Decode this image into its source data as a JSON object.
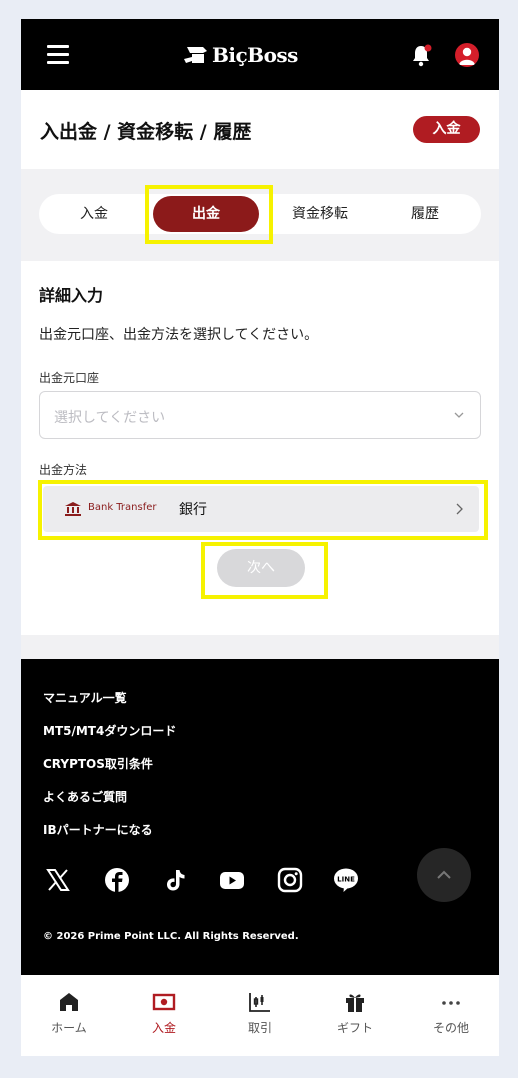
{
  "header": {
    "brand": "BiçBoss",
    "icons": [
      "menu-icon",
      "notification-bell-icon",
      "user-avatar-icon"
    ],
    "accent_color": "#b01c22",
    "dark_bg": "#000000"
  },
  "page": {
    "title": "入出金 / 資金移転 / 履歴",
    "badge": "入金"
  },
  "tabs": [
    {
      "label": "入金",
      "active": false
    },
    {
      "label": "出金",
      "active": true
    },
    {
      "label": "資金移転",
      "active": false
    },
    {
      "label": "履歴",
      "active": false
    }
  ],
  "form": {
    "section_title": "詳細入力",
    "description": "出金元口座、出金方法を選択してください。",
    "source_label": "出金元口座",
    "source_placeholder": "選択してください",
    "method_label": "出金方法",
    "method": {
      "badge_text": "Bank Transfer",
      "name": "銀行"
    },
    "next_button": "次へ"
  },
  "footer": {
    "links": [
      "マニュアル一覧",
      "MT5/MT4ダウンロード",
      "CRYPTOS取引条件",
      "よくあるご質問",
      "IBパートナーになる"
    ],
    "social_icons": [
      "x-icon",
      "facebook-icon",
      "tiktok-icon",
      "youtube-icon",
      "instagram-icon",
      "line-icon"
    ],
    "copyright": "© 2026 Prime Point LLC. All Rights Reserved."
  },
  "bottom_nav": [
    {
      "label": "ホーム",
      "icon": "home-icon",
      "active": false
    },
    {
      "label": "入金",
      "icon": "deposit-icon",
      "active": true
    },
    {
      "label": "取引",
      "icon": "trade-chart-icon",
      "active": false
    },
    {
      "label": "ギフト",
      "icon": "gift-icon",
      "active": false
    },
    {
      "label": "その他",
      "icon": "more-icon",
      "active": false
    }
  ]
}
